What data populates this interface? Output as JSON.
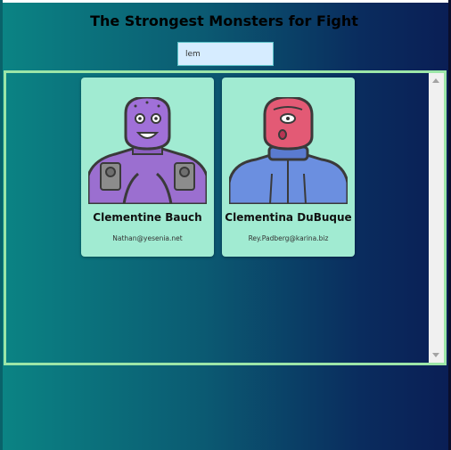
{
  "header": {
    "title": "The Strongest Monsters for Fight"
  },
  "search": {
    "value": "lem"
  },
  "cards": [
    {
      "name": "Clementine Bauch",
      "email": "Nathan@yesenia.net"
    },
    {
      "name": "Clementina DuBuque",
      "email": "Rey.Padberg@karina.biz"
    }
  ],
  "colors": {
    "card_background": "#a1ebd2",
    "panel_border": "#9ce6a8",
    "search_background": "#d6ecff"
  }
}
